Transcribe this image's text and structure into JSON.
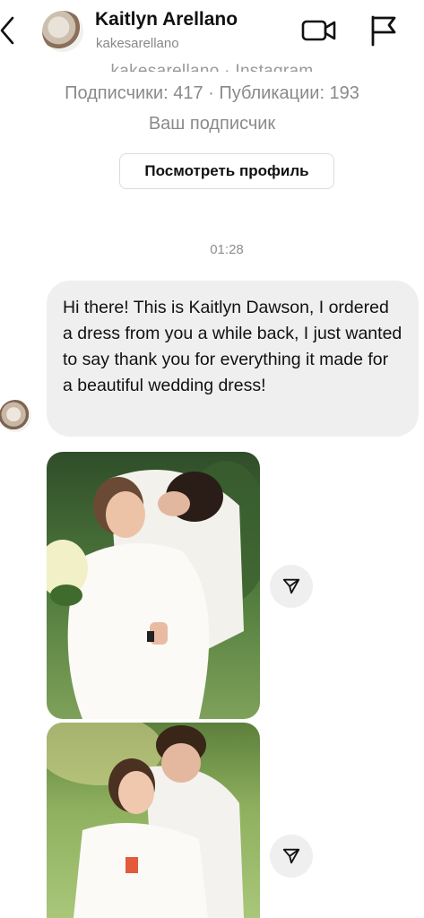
{
  "header": {
    "display_name": "Kaitlyn Arellano",
    "username": "kakesarellano",
    "icons": [
      "chevron-left-icon",
      "video-call-icon",
      "flag-icon"
    ]
  },
  "profile_card": {
    "handle_line": "kakesarellano · Instagram",
    "stats": "Подписчики: 417 · Публикации: 193",
    "relation": "Ваш подписчик",
    "view_profile_button": "Посмотреть профиль"
  },
  "thread": {
    "timestamp": "01:28",
    "message_text": "Hi there! This is Kaitlyn Dawson, I ordered a dress from you a while back, I just wanted to say thank you for everything it made for a beautiful wedding dress!",
    "shared_photos": [
      "wedding-couple-photo",
      "wedding-couple-photo"
    ]
  },
  "colors": {
    "bubble": "#efefef",
    "secondary_text": "#8a8a8a",
    "button_border": "#dbdbdb"
  }
}
